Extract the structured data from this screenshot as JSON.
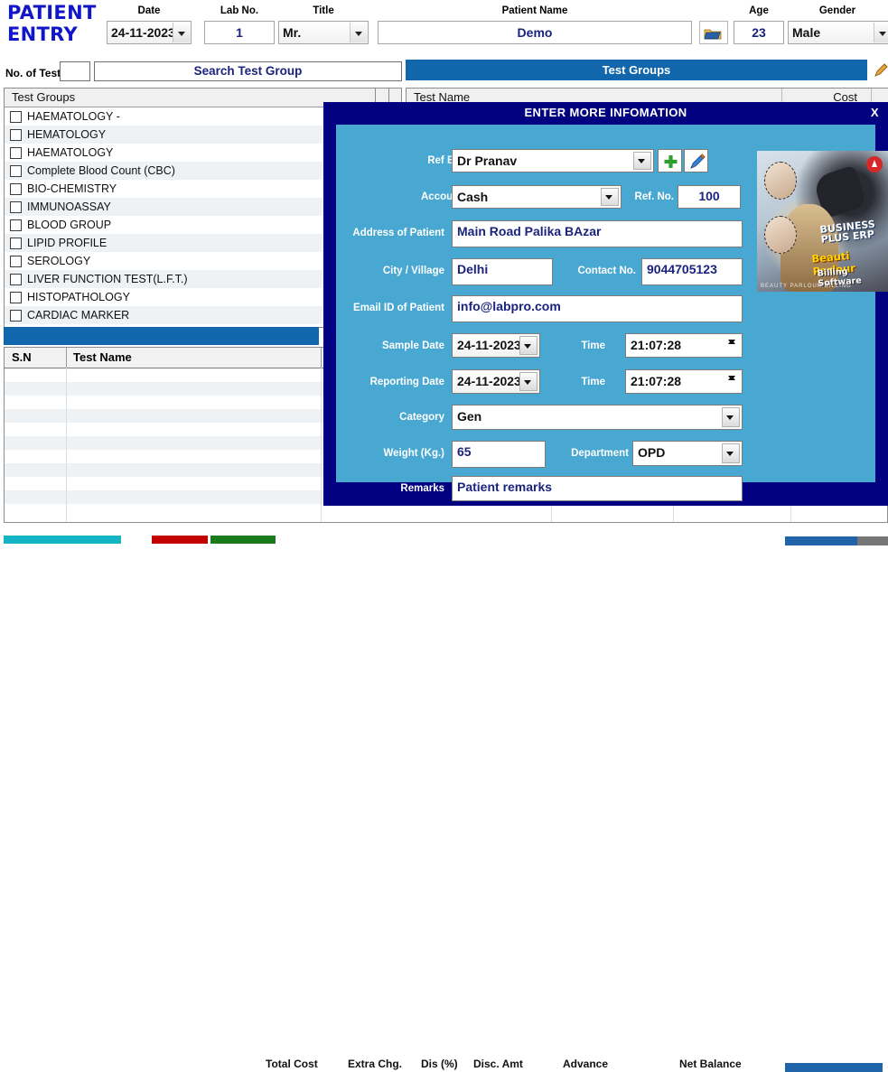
{
  "header": {
    "brand_line1": "PATIENT",
    "brand_line2": "ENTRY",
    "labels": {
      "date": "Date",
      "lab_no": "Lab No.",
      "title": "Title",
      "patient_name": "Patient Name",
      "age": "Age",
      "gender": "Gender"
    },
    "values": {
      "date": "24-11-2023",
      "lab_no": "1",
      "title": "Mr.",
      "patient_name": "Demo",
      "age": "23",
      "gender": "Male"
    }
  },
  "search_row": {
    "no_of_tests_label": "No. of Tests",
    "no_of_tests_value": "",
    "search_placeholder": "Search Test Group",
    "test_groups_banner": "Test Groups"
  },
  "test_group_list": {
    "column_header": "Test Groups",
    "items": [
      "HAEMATOLOGY -",
      "HEMATOLOGY",
      "HAEMATOLOGY",
      "Complete Blood Count (CBC)",
      "BIO-CHEMISTRY",
      "IMMUNOASSAY",
      "BLOOD GROUP",
      "LIPID PROFILE",
      "SEROLOGY",
      "LIVER FUNCTION TEST(L.F.T.)",
      "HISTOPATHOLOGY",
      "CARDIAC MARKER"
    ]
  },
  "test_grid": {
    "col_test_name": "Test Name",
    "col_cost": "Cost"
  },
  "selected_tests_table": {
    "col_sn": "S.N",
    "col_test_name": "Test Name",
    "rows": []
  },
  "bottom_bar": {
    "labels": {
      "total_cost": "Total Cost",
      "extra_chg": "Extra Chg.",
      "dis_pct": "Dis (%)",
      "disc_amt": "Disc. Amt",
      "advance": "Advance",
      "net_balance": "Net Balance"
    },
    "colors": {
      "cyan": "#14b4c4",
      "red": "#c20000",
      "green": "#1b7a1b",
      "blue": "#1f63a8",
      "gray": "#767676"
    }
  },
  "modal": {
    "title": "ENTER MORE INFOMATION",
    "close_label": "X",
    "title_bar_color": "#000080",
    "body_color": "#49a8d2",
    "fields": {
      "ref_by_label": "Ref By.",
      "ref_by_value": "Dr Pranav",
      "account_label": "Account",
      "account_value": "Cash",
      "ref_no_label": "Ref. No.",
      "ref_no_value": "100",
      "address_label": "Address of Patient",
      "address_value": "Main Road Palika BAzar",
      "city_label": "City / Village",
      "city_value": "Delhi",
      "contact_label": "Contact No.",
      "contact_value": "9044705123",
      "email_label": "Email ID of Patient",
      "email_value": "info@labpro.com",
      "sample_date_label": "Sample Date",
      "sample_date_value": "24-11-2023",
      "sample_time_label": "Time",
      "sample_time_value": "21:07:28",
      "reporting_date_label": "Reporting Date",
      "reporting_date_value": "24-11-2023",
      "reporting_time_label": "Time",
      "reporting_time_value": "21:07:28",
      "category_label": "Category",
      "category_value": "Gen",
      "weight_label": "Weight (Kg.)",
      "weight_value": "65",
      "department_label": "Department",
      "department_value": "OPD",
      "remarks_label": "Remarks",
      "remarks_value": "Patient remarks"
    },
    "ad": {
      "line1": "BUSINESS PLUS ERP",
      "line2": "Beauti Parlour",
      "line3": "Billing Software",
      "footer": "BEAUTY PARLOUR BILLING"
    }
  }
}
